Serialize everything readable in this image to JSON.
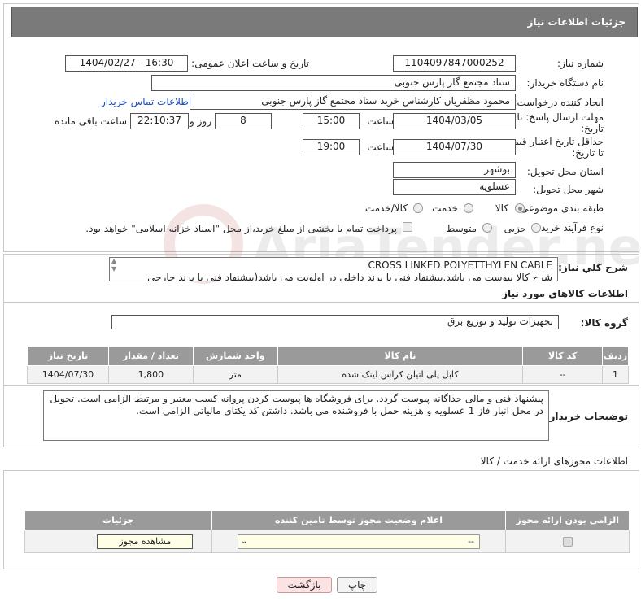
{
  "header": {
    "title": "جزئیات اطلاعات نیاز"
  },
  "form": {
    "need_number_label": "شماره نیاز:",
    "need_number": "1104097847000252",
    "announce_label": "تاریخ و ساعت اعلان عمومی:",
    "announce_value": "1404/02/27 - 16:30",
    "buyer_org_label": "نام دستگاه خریدار:",
    "buyer_org": "ستاد مجتمع گاز پارس جنوبی",
    "creator_label": "ایجاد کننده درخواست:",
    "creator": "محمود مظفریان کارشناس خرید ستاد مجتمع گاز پارس جنوبی",
    "contact_link": "اطلاعات تماس خریدار",
    "deadline_label_1": "مهلت ارسال پاسخ: تا",
    "deadline_label_2": "تاریخ:",
    "deadline_date": "1404/03/05",
    "time_label": "ساعت",
    "deadline_time": "15:00",
    "days_value": "8",
    "days_label": "روز و",
    "remaining_value": "22:10:37",
    "remaining_label": "ساعت باقی مانده",
    "validity_label_1": "حداقل تاریخ اعتبار قیمت:",
    "validity_label_2": "تا تاریخ:",
    "validity_date": "1404/07/30",
    "validity_time": "19:00",
    "province_label": "استان محل تحویل:",
    "province": "بوشهر",
    "city_label": "شهر محل تحویل:",
    "city": "عسلویه",
    "category_label": "طبقه بندی موضوعی:",
    "category_options": [
      "کالا",
      "خدمت",
      "کالا/خدمت"
    ],
    "category_selected": "کالا",
    "process_label": "نوع فرآیند خرید :",
    "process_options": [
      "جزیی",
      "متوسط"
    ],
    "process_note": "پرداخت تمام یا بخشی از مبلغ خرید،از محل \"اسناد خزانه اسلامی\" خواهد بود."
  },
  "description": {
    "label": "شرح كلي نياز:",
    "line1": "CROSS LINKED POLYETTHYLEN CABLE",
    "line2": "شرح کالا پیوست می باشد.پیشنهاد فنی با برند داخلی در اولویت می باشد(پیشنهاد فنی با برند خارجی"
  },
  "goods": {
    "section_title": "اطلاعات کالاهای مورد نیاز",
    "group_label": "گروه کالا:",
    "group_value": "تجهیزات تولید و توزیع برق",
    "columns": [
      "ردیف",
      "کد کالا",
      "نام کالا",
      "واحد شمارش",
      "تعداد / مقدار",
      "تاریخ نیاز"
    ],
    "rows": [
      {
        "row": "1",
        "code": "--",
        "name": "کابل پلی اتیلن کراس لینک شده",
        "unit": "متر",
        "qty": "1,800",
        "date": "1404/07/30"
      }
    ]
  },
  "buyer_notes": {
    "label": "توضیحات خریدار:",
    "text": "پیشنهاد فنی و مالی جداگانه پیوست گردد. برای فروشگاه ها پیوست کردن پروانه کسب معتبر و مرتبط الزامی است. تحویل در محل انبار فاز 1 عسلویه و هزینه حمل با فروشنده می باشد. داشتن کد یکتای مالیاتی الزامی است."
  },
  "permits": {
    "section_title": "اطلاعات مجوزهای ارائه خدمت / کالا",
    "columns": [
      "الزامی بودن ارائه مجوز",
      "اعلام وضعیت مجوز توسط تامین کننده",
      "جزئیات"
    ],
    "select_value": "--",
    "view_button": "مشاهده مجوز"
  },
  "footer": {
    "print_button": "چاپ",
    "back_button": "بازگشت"
  },
  "watermark": {
    "text": "AriaTender.neT"
  }
}
